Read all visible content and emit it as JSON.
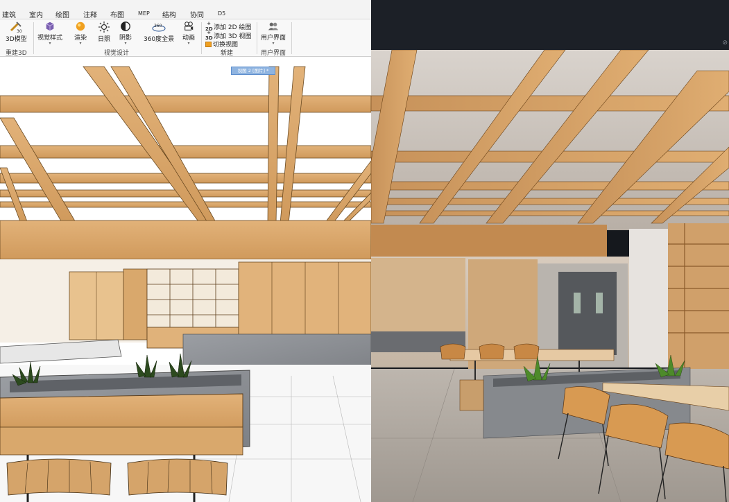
{
  "menu": [
    "建筑",
    "室内",
    "绘图",
    "注释",
    "布图",
    "MEP",
    "结构",
    "协同",
    "D5"
  ],
  "ribbon": {
    "model3d": "3D模型",
    "visual_style": "视觉样式",
    "render": "渲染",
    "sun": "日照",
    "shadow": "阴影",
    "pano": "360度全景",
    "anim": "动画",
    "add2d": "添加 2D 绘图",
    "add3d": "添加 3D 视图",
    "switch": "切换视图",
    "ui": "用户界面",
    "groups": {
      "rebuild": "重建3D",
      "visual": "视觉设计",
      "new": "新建",
      "ui": "用户界面"
    },
    "icons": {
      "model3d": "3d-model-icon",
      "visual_style": "cube-icon",
      "render": "teapot-sphere-icon",
      "sun": "sun-icon",
      "shadow": "shadow-icon",
      "pano": "360-panorama-icon",
      "anim": "camera-icon",
      "add2d": "add-2d-icon",
      "add3d": "add-3d-icon",
      "switch": "switch-view-icon",
      "ui": "users-icon"
    }
  },
  "viewport_tab": "视图 2 [图片] *",
  "right_panel": {
    "corner_glyph": "⊘"
  },
  "colors": {
    "wood": "#d7a56a",
    "wood_dark": "#b88048",
    "stone": "#8a8d92",
    "ribbon_bg": "#f8f8f8",
    "accent_tab": "#8fb4e0"
  }
}
